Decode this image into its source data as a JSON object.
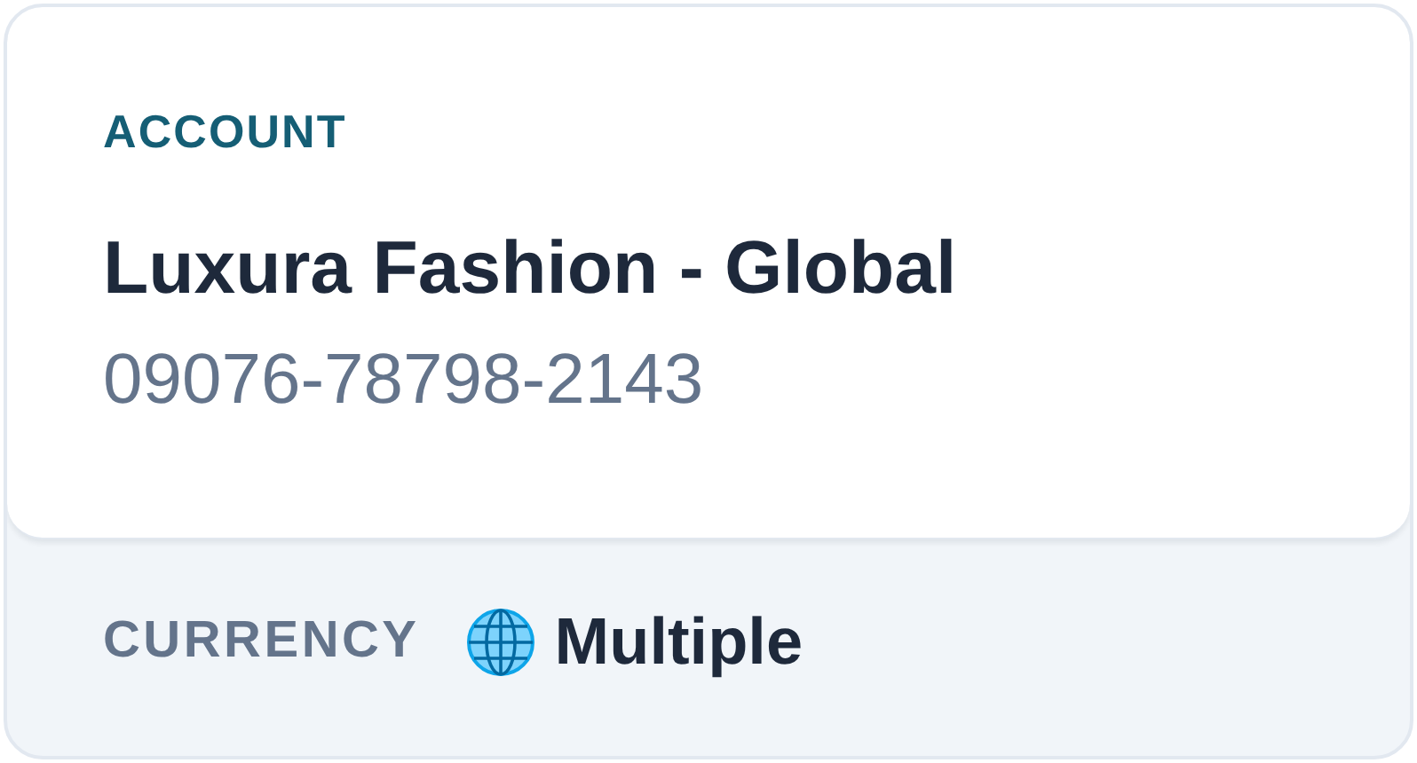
{
  "account": {
    "label": "ACCOUNT",
    "name": "Luxura Fashion - Global",
    "number": "09076-78798-2143"
  },
  "currency": {
    "label": "CURRENCY",
    "value": "Multiple"
  }
}
